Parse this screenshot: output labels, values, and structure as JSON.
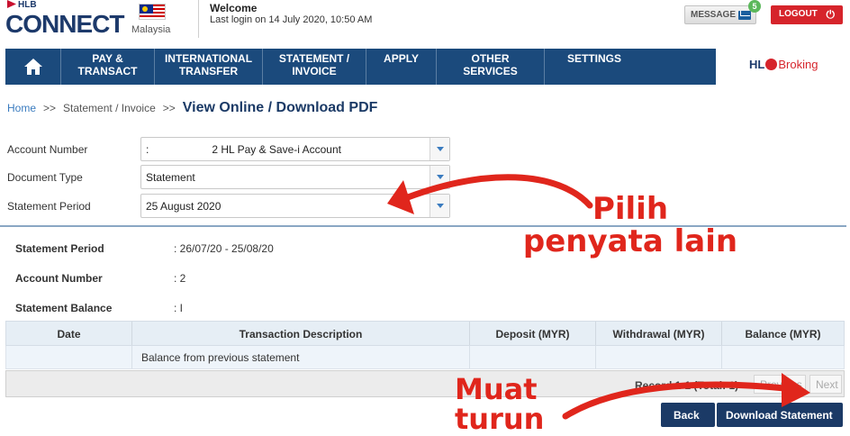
{
  "header": {
    "brand_small": "HLB",
    "brand_main": "CONNECT",
    "country": "Malaysia",
    "welcome": "Welcome",
    "last_login": "Last login on 14 July 2020, 10:50 AM",
    "message_label": "MESSAGE",
    "message_count": "5",
    "logout_label": "LOGOUT"
  },
  "nav": {
    "home_icon": "home-icon",
    "items": [
      {
        "label": "PAY &\nTRANSACT"
      },
      {
        "label": "INTERNATIONAL\nTRANSFER"
      },
      {
        "label": "STATEMENT /\nINVOICE"
      },
      {
        "label": "APPLY"
      },
      {
        "label": "OTHER\nSERVICES"
      },
      {
        "label": "SETTINGS"
      }
    ],
    "partner_prefix": "HL",
    "partner_suffix": "Broking"
  },
  "breadcrumb": {
    "home": "Home",
    "sep": ">>",
    "level1": "Statement / Invoice",
    "current": "View Online / Download PDF"
  },
  "form": {
    "account_number_label": "Account Number",
    "account_number_value": "2 HL Pay & Save-i Account",
    "document_type_label": "Document Type",
    "document_type_value": "Statement",
    "statement_period_label": "Statement Period",
    "statement_period_value": "25 August 2020"
  },
  "summary": {
    "period_label": "Statement Period",
    "period_value": ": 26/07/20 - 25/08/20",
    "account_label": "Account Number",
    "account_value": ":        2",
    "balance_label": "Statement Balance",
    "balance_value": ": I"
  },
  "table": {
    "headers": [
      "Date",
      "Transaction Description",
      "Deposit (MYR)",
      "Withdrawal (MYR)",
      "Balance (MYR)"
    ],
    "rows": [
      [
        "",
        "Balance from previous statement",
        "",
        "",
        ""
      ]
    ]
  },
  "pager": {
    "record": "Record 1-1 (Total: 1)",
    "previous": "Previous",
    "next": "Next"
  },
  "actions": {
    "back": "Back",
    "download": "Download Statement"
  },
  "annotations": {
    "pilih_line1": "Pilih",
    "pilih_line2": "penyata lain",
    "muat_line1": "Muat",
    "muat_line2": "turun",
    "color": "#e0261c"
  },
  "colors": {
    "nav_bg": "#1b4a7c",
    "brand_navy": "#1d3a6b",
    "logout_red": "#d6242b",
    "button_navy": "#1b3a66"
  }
}
